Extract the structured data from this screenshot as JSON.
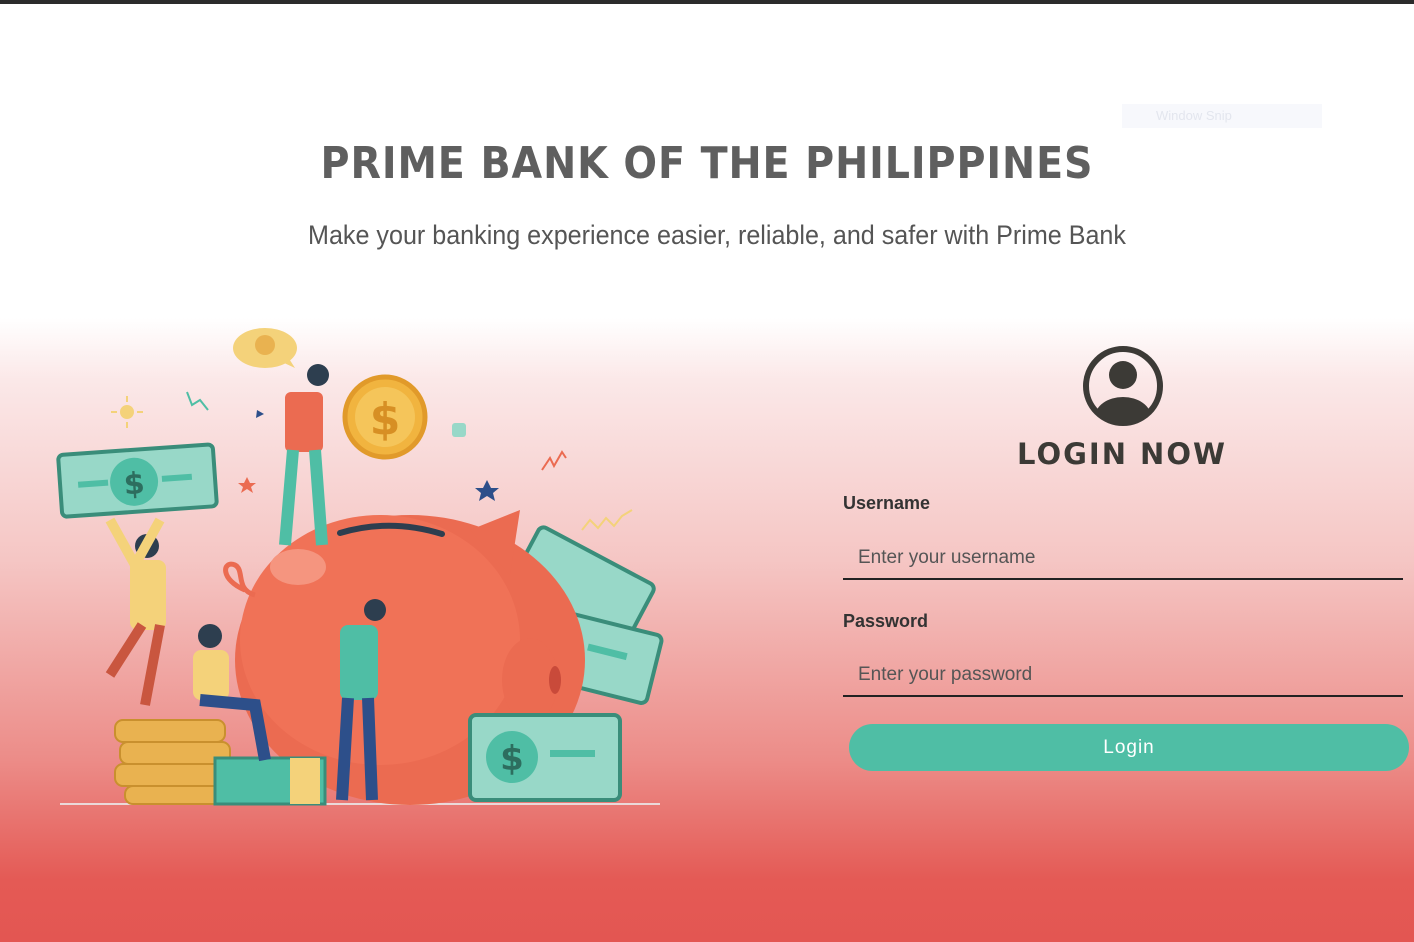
{
  "header": {
    "title": "PRIME BANK OF THE PHILIPPINES",
    "subtitle": "Make your banking experience easier, reliable, and safer with Prime Bank"
  },
  "overlay": {
    "snip_label": "Window Snip"
  },
  "login": {
    "heading": "LOGIN NOW",
    "username_label": "Username",
    "username_placeholder": "Enter your username",
    "username_value": "",
    "password_label": "Password",
    "password_placeholder": "Enter your password",
    "password_value": "",
    "button_label": "Login"
  },
  "icons": {
    "user": "user-account-icon",
    "illustration": "piggy-bank-savings-illustration"
  },
  "colors": {
    "accent": "#4fbea5",
    "title": "#5f5f5f",
    "gradient_bottom": "#e35652",
    "coral": "#f07257"
  }
}
